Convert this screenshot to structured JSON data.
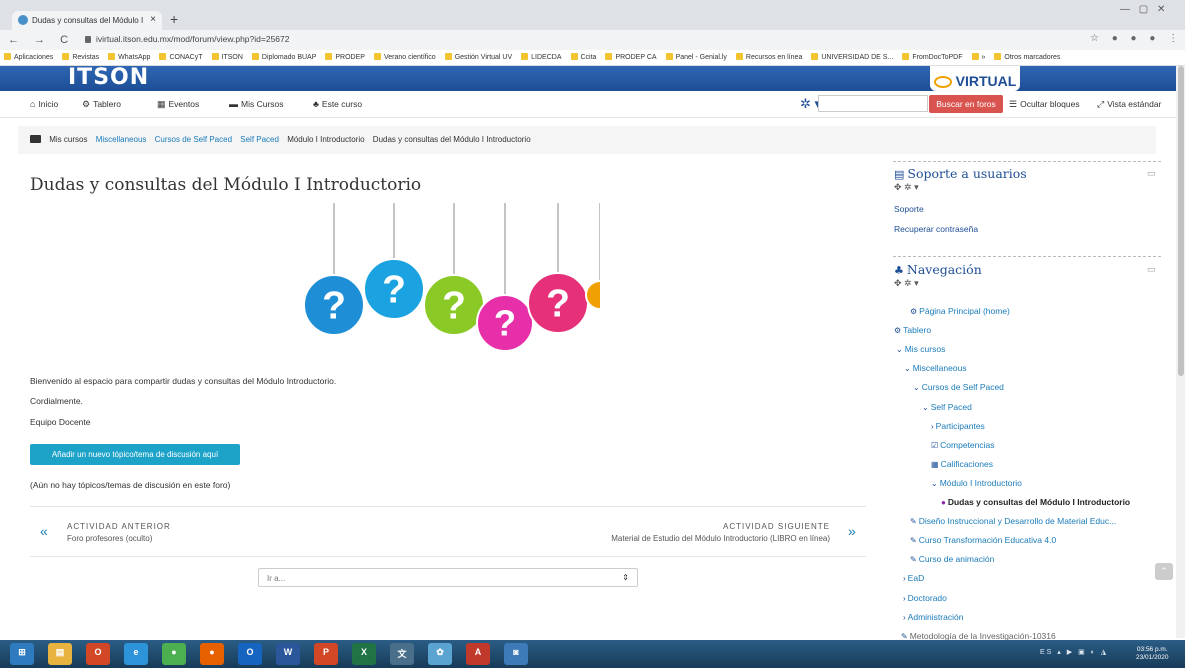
{
  "browser": {
    "tab_title": "Dudas y consultas del Módulo I",
    "tab_close": "×",
    "new_tab": "+",
    "url": "ivirtual.itson.edu.mx/mod/forum/view.php?id=25672",
    "nav_glyphs": "← → C",
    "window_controls": "— ▢ ✕",
    "addr_icons": "☆ ● ● ● ⋮",
    "bookmarks": [
      "Aplicaciones",
      "Revistas",
      "WhatsApp",
      "CONACyT",
      "ITSON",
      "Diplomado BUAP",
      "PRODEP",
      "Verano científico",
      "Gestión Virtual UV",
      "LIDECDA",
      "Ccita",
      "PRODEP CA",
      "Panel - Genial.ly",
      "Recursos en línea",
      "UNIVERSIDAD DE S...",
      "FromDocToPDF",
      "»",
      "Otros marcadores"
    ]
  },
  "banner": {
    "logo_left": "ITSON",
    "logo_right": "VIRTUAL"
  },
  "navbar": {
    "items": [
      {
        "label": "Inicio",
        "icon": "home-icon",
        "glyph": "⌂"
      },
      {
        "label": "Tablero",
        "icon": "dashboard-icon",
        "glyph": "⚙"
      },
      {
        "label": "Eventos",
        "icon": "calendar-icon",
        "glyph": "▦"
      },
      {
        "label": "Mis Cursos",
        "icon": "courses-icon",
        "glyph": "▬"
      },
      {
        "label": "Este curso",
        "icon": "sitemap-icon",
        "glyph": "♣"
      }
    ],
    "gear_glyph": "✲ ▾ ❓",
    "search_button": "Buscar en foros",
    "hide_blocks": "Ocultar bloques",
    "standard_view": "Vista estándar",
    "hide_blocks_glyph": "☰",
    "standard_view_glyph": "⤢"
  },
  "breadcrumb": [
    "Mis cursos",
    "Miscellaneous",
    "Cursos de Self Paced",
    "Self Paced",
    "Módulo I Introductorio",
    "Dudas y consultas del Módulo I Introductorio"
  ],
  "main": {
    "title": "Dudas y consultas del Módulo I Introductorio",
    "intro": "Bienvenido al espacio para compartir dudas y consultas del Módulo Introductorio.",
    "greeting": "Cordialmente.",
    "signature": "Equipo Docente",
    "add_button": "Añadir un nuevo tópico/tema de discusión aquí",
    "no_topics": "(Aún no hay tópicos/temas de discusión en este foro)",
    "prev_label": "ACTIVIDAD ANTERIOR",
    "prev_text": "Foro profesores (oculto)",
    "next_label": "ACTIVIDAD SIGUIENTE",
    "next_text": "Material de Estudio del Módulo Introductorio (LIBRO en línea)",
    "prev_arrow": "«",
    "next_arrow": "»",
    "jump_placeholder": "Ir a...",
    "jump_chevron": "⇕"
  },
  "sidebar": {
    "support": {
      "title": "Soporte a usuarios",
      "controls": "✥ ✲ ▾",
      "dock": "▭",
      "links": [
        "Soporte",
        "Recuperar contraseña"
      ]
    },
    "navigation": {
      "title": "Navegación",
      "controls": "✥ ✲ ▾",
      "dock": "▭",
      "items": [
        {
          "label": "Página Principal (home)",
          "glyph": "⚙"
        },
        {
          "label": "Tablero",
          "glyph": "⚙"
        },
        {
          "label": "Mis cursos",
          "glyph": "⌄"
        },
        {
          "label": "Miscellaneous",
          "glyph": "⌄"
        },
        {
          "label": "Cursos de Self Paced",
          "glyph": "⌄"
        },
        {
          "label": "Self Paced",
          "glyph": "⌄"
        },
        {
          "label": "Participantes",
          "glyph": "›"
        },
        {
          "label": "Competencias",
          "glyph": "☑"
        },
        {
          "label": "Calificaciones",
          "glyph": "▦"
        },
        {
          "label": "Módulo I Introductorio",
          "glyph": "⌄"
        },
        {
          "label": "Dudas y consultas del Módulo I Introductorio",
          "glyph": "●"
        },
        {
          "label": "Diseño Instruccional y Desarrollo de Material Educ...",
          "glyph": "✎"
        },
        {
          "label": "Curso Transformación Educativa 4.0",
          "glyph": "✎"
        },
        {
          "label": "Curso de animación",
          "glyph": "✎"
        },
        {
          "label": "EaD",
          "glyph": "›"
        },
        {
          "label": "Doctorado",
          "glyph": "›"
        },
        {
          "label": "Administración",
          "glyph": "›"
        },
        {
          "label": "Metodología de la Investigación-10316",
          "glyph": "✎"
        }
      ]
    }
  },
  "illustration": {
    "tags": [
      {
        "color": "#1e8fd6",
        "glyph": "?"
      },
      {
        "color": "#1aa3e0",
        "glyph": "?"
      },
      {
        "color": "#8ac926",
        "glyph": "?"
      },
      {
        "color": "#e62fa8",
        "glyph": "?"
      },
      {
        "color": "#e6307a",
        "glyph": "?"
      },
      {
        "color": "#f0a000",
        "glyph": ""
      }
    ]
  },
  "taskbar": {
    "apps": [
      {
        "icon": "windows-start-icon",
        "color": "#2e7bc0",
        "glyph": "⊞"
      },
      {
        "icon": "file-explorer-icon",
        "color": "#e9b33f",
        "glyph": "▤"
      },
      {
        "icon": "outlook-icon",
        "color": "#d24726",
        "glyph": "O"
      },
      {
        "icon": "ie-icon",
        "color": "#2e94d9",
        "glyph": "e"
      },
      {
        "icon": "chrome-icon",
        "color": "#4caf50",
        "glyph": "●"
      },
      {
        "icon": "firefox-icon",
        "color": "#e66000",
        "glyph": "●"
      },
      {
        "icon": "outlook2-icon",
        "color": "#1565c0",
        "glyph": "O"
      },
      {
        "icon": "word-icon",
        "color": "#2b579a",
        "glyph": "W"
      },
      {
        "icon": "powerpoint-icon",
        "color": "#d24726",
        "glyph": "P"
      },
      {
        "icon": "excel-icon",
        "color": "#217346",
        "glyph": "X"
      },
      {
        "icon": "language-icon",
        "color": "#4a6f8a",
        "glyph": "文"
      },
      {
        "icon": "photos-icon",
        "color": "#5ba3d0",
        "glyph": "✿"
      },
      {
        "icon": "acrobat-icon",
        "color": "#c0392b",
        "glyph": "A"
      },
      {
        "icon": "app-icon",
        "color": "#3d7ab8",
        "glyph": "◙"
      }
    ],
    "tray": "ES ▴ ▶ ▣ ◐ ◮",
    "time": "03:56 p.m.",
    "date": "23/01/2020"
  },
  "scroll_top": "⌃"
}
